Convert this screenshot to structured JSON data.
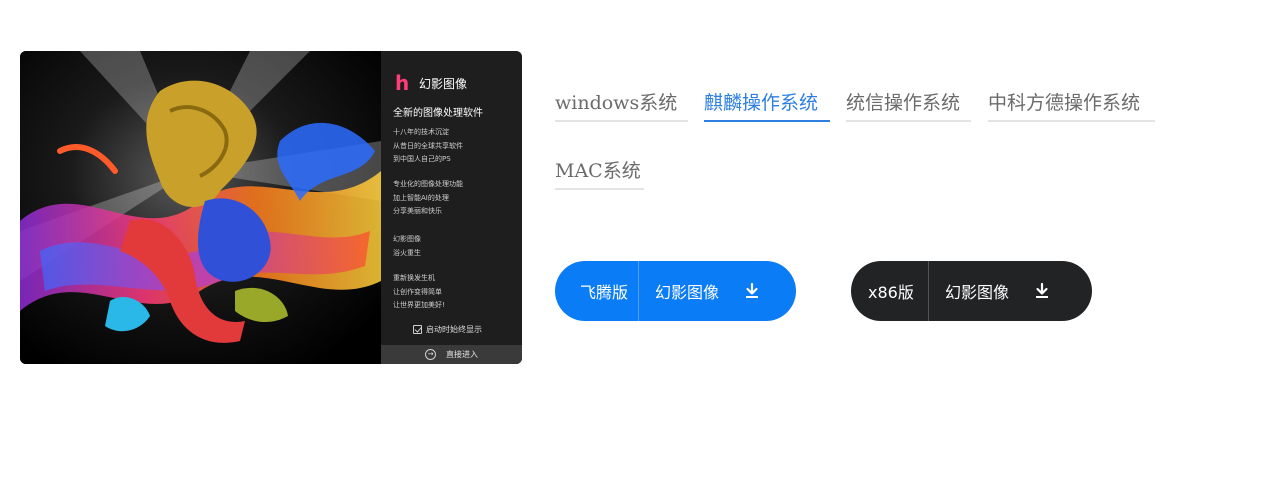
{
  "splash": {
    "logo": "h",
    "brand_name": "幻影图像",
    "tagline": "全新的图像处理软件",
    "feature_groups": [
      [
        "十八年的技术沉淀",
        "从昔日的全球共享软件",
        "到中国人自己的PS"
      ],
      [
        "专业化的图像处理功能",
        "加上智能AI的处理",
        "分享美丽和快乐"
      ],
      [
        "幻影图像",
        "浴火重生"
      ],
      [
        "重新换发生机",
        "让创作变得简单",
        "让世界更加美好!"
      ]
    ],
    "startup_checkbox_label": "启动时始终显示",
    "enter_button_label": "直接进入"
  },
  "os_tabs": [
    {
      "label": "windows系统",
      "active": false
    },
    {
      "label": "麒麟操作系统",
      "active": true
    },
    {
      "label": "统信操作系统",
      "active": false
    },
    {
      "label": "中科方德操作系统",
      "active": false
    },
    {
      "label": "MAC系统",
      "active": false
    }
  ],
  "downloads": [
    {
      "version": "飞腾版",
      "app_name": "幻影图像",
      "icon": "download-icon",
      "color": "#0a7cf5"
    },
    {
      "version": "x86版",
      "app_name": "幻影图像",
      "icon": "download-icon",
      "color": "#222325"
    }
  ],
  "colors": {
    "accent": "#2f7fe0",
    "primary_button": "#0a7cf5",
    "dark_button": "#222325",
    "brand": "#ff3d7a"
  }
}
